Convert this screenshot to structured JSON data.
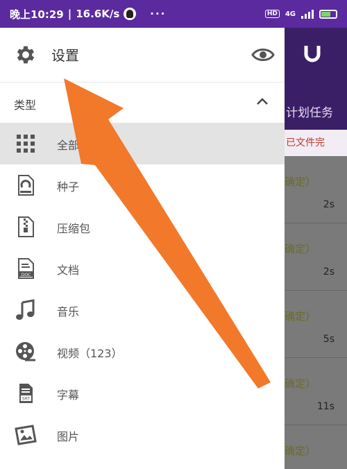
{
  "status_bar": {
    "time": "晚上10:29",
    "speed": "16.6K/s",
    "dots": "···",
    "network": "4G"
  },
  "drawer": {
    "settings_label": "设置",
    "section_label": "类型",
    "items": [
      {
        "label": "全部（251）",
        "icon": "grid-icon"
      },
      {
        "label": "种子",
        "icon": "torrent-file-icon"
      },
      {
        "label": "压缩包",
        "icon": "zip-file-icon"
      },
      {
        "label": "文档",
        "icon": "doc-file-icon"
      },
      {
        "label": "音乐",
        "icon": "music-note-icon"
      },
      {
        "label": "视频（123）",
        "icon": "film-reel-icon"
      },
      {
        "label": "字幕",
        "icon": "subtitle-file-icon"
      },
      {
        "label": "图片",
        "icon": "image-icon"
      }
    ]
  },
  "background_app": {
    "tab_label": "计划任务",
    "bar_text": "已文件完",
    "list": [
      {
        "text": "确定）",
        "size": "2s"
      },
      {
        "text": "确定）",
        "size": "2s"
      },
      {
        "text": "确定）",
        "size": "5s"
      },
      {
        "text": "确定）",
        "size": "11s"
      },
      {
        "text": "确定）",
        "size": ""
      }
    ]
  },
  "colors": {
    "status_bar": "#5b2a9e",
    "app_header": "#3b1f66",
    "arrow": "#f2782a",
    "selected_row": "#e3e3e3"
  }
}
